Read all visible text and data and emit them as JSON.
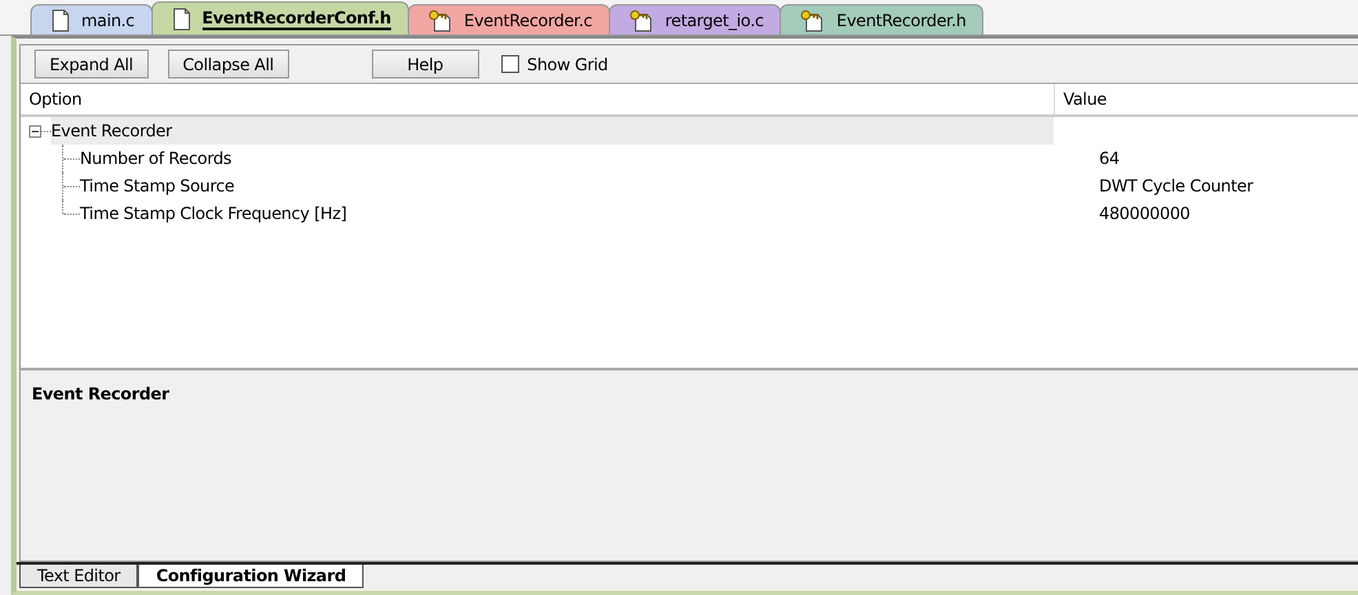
{
  "file_tabs": [
    {
      "label": "main.c",
      "kind": "plain",
      "color": "#c8d5ef",
      "selected": false
    },
    {
      "label": "EventRecorderConf.h",
      "kind": "plain",
      "color": "#c5d8a4",
      "selected": true
    },
    {
      "label": "EventRecorder.c",
      "kind": "key",
      "color": "#f2a6a2",
      "selected": false
    },
    {
      "label": "retarget_io.c",
      "kind": "key",
      "color": "#c2aae2",
      "selected": false
    },
    {
      "label": "EventRecorder.h",
      "kind": "key",
      "color": "#a2cbb9",
      "selected": false
    }
  ],
  "toolbar": {
    "buttons": [
      "Expand All",
      "Collapse All",
      "Help"
    ],
    "show_grid": {
      "label": "Show Grid",
      "checked": false
    }
  },
  "table": {
    "columns": [
      "Option",
      "Value"
    ],
    "rows": [
      {
        "option": "Event Recorder",
        "value": "",
        "expanded": true,
        "selected": true,
        "children": [
          {
            "option": "Number of Records",
            "value": "64",
            "selected": false
          },
          {
            "option": "Time Stamp Source",
            "value": "DWT Cycle Counter",
            "selected": false
          },
          {
            "option": "Time Stamp Clock Frequency [Hz]",
            "value": "480000000",
            "selected": false
          }
        ]
      }
    ]
  },
  "description": {
    "title": "Event Recorder"
  },
  "view_tabs": [
    {
      "label": "Text Editor",
      "selected": false
    },
    {
      "label": "Configuration Wizard",
      "selected": true
    }
  ]
}
